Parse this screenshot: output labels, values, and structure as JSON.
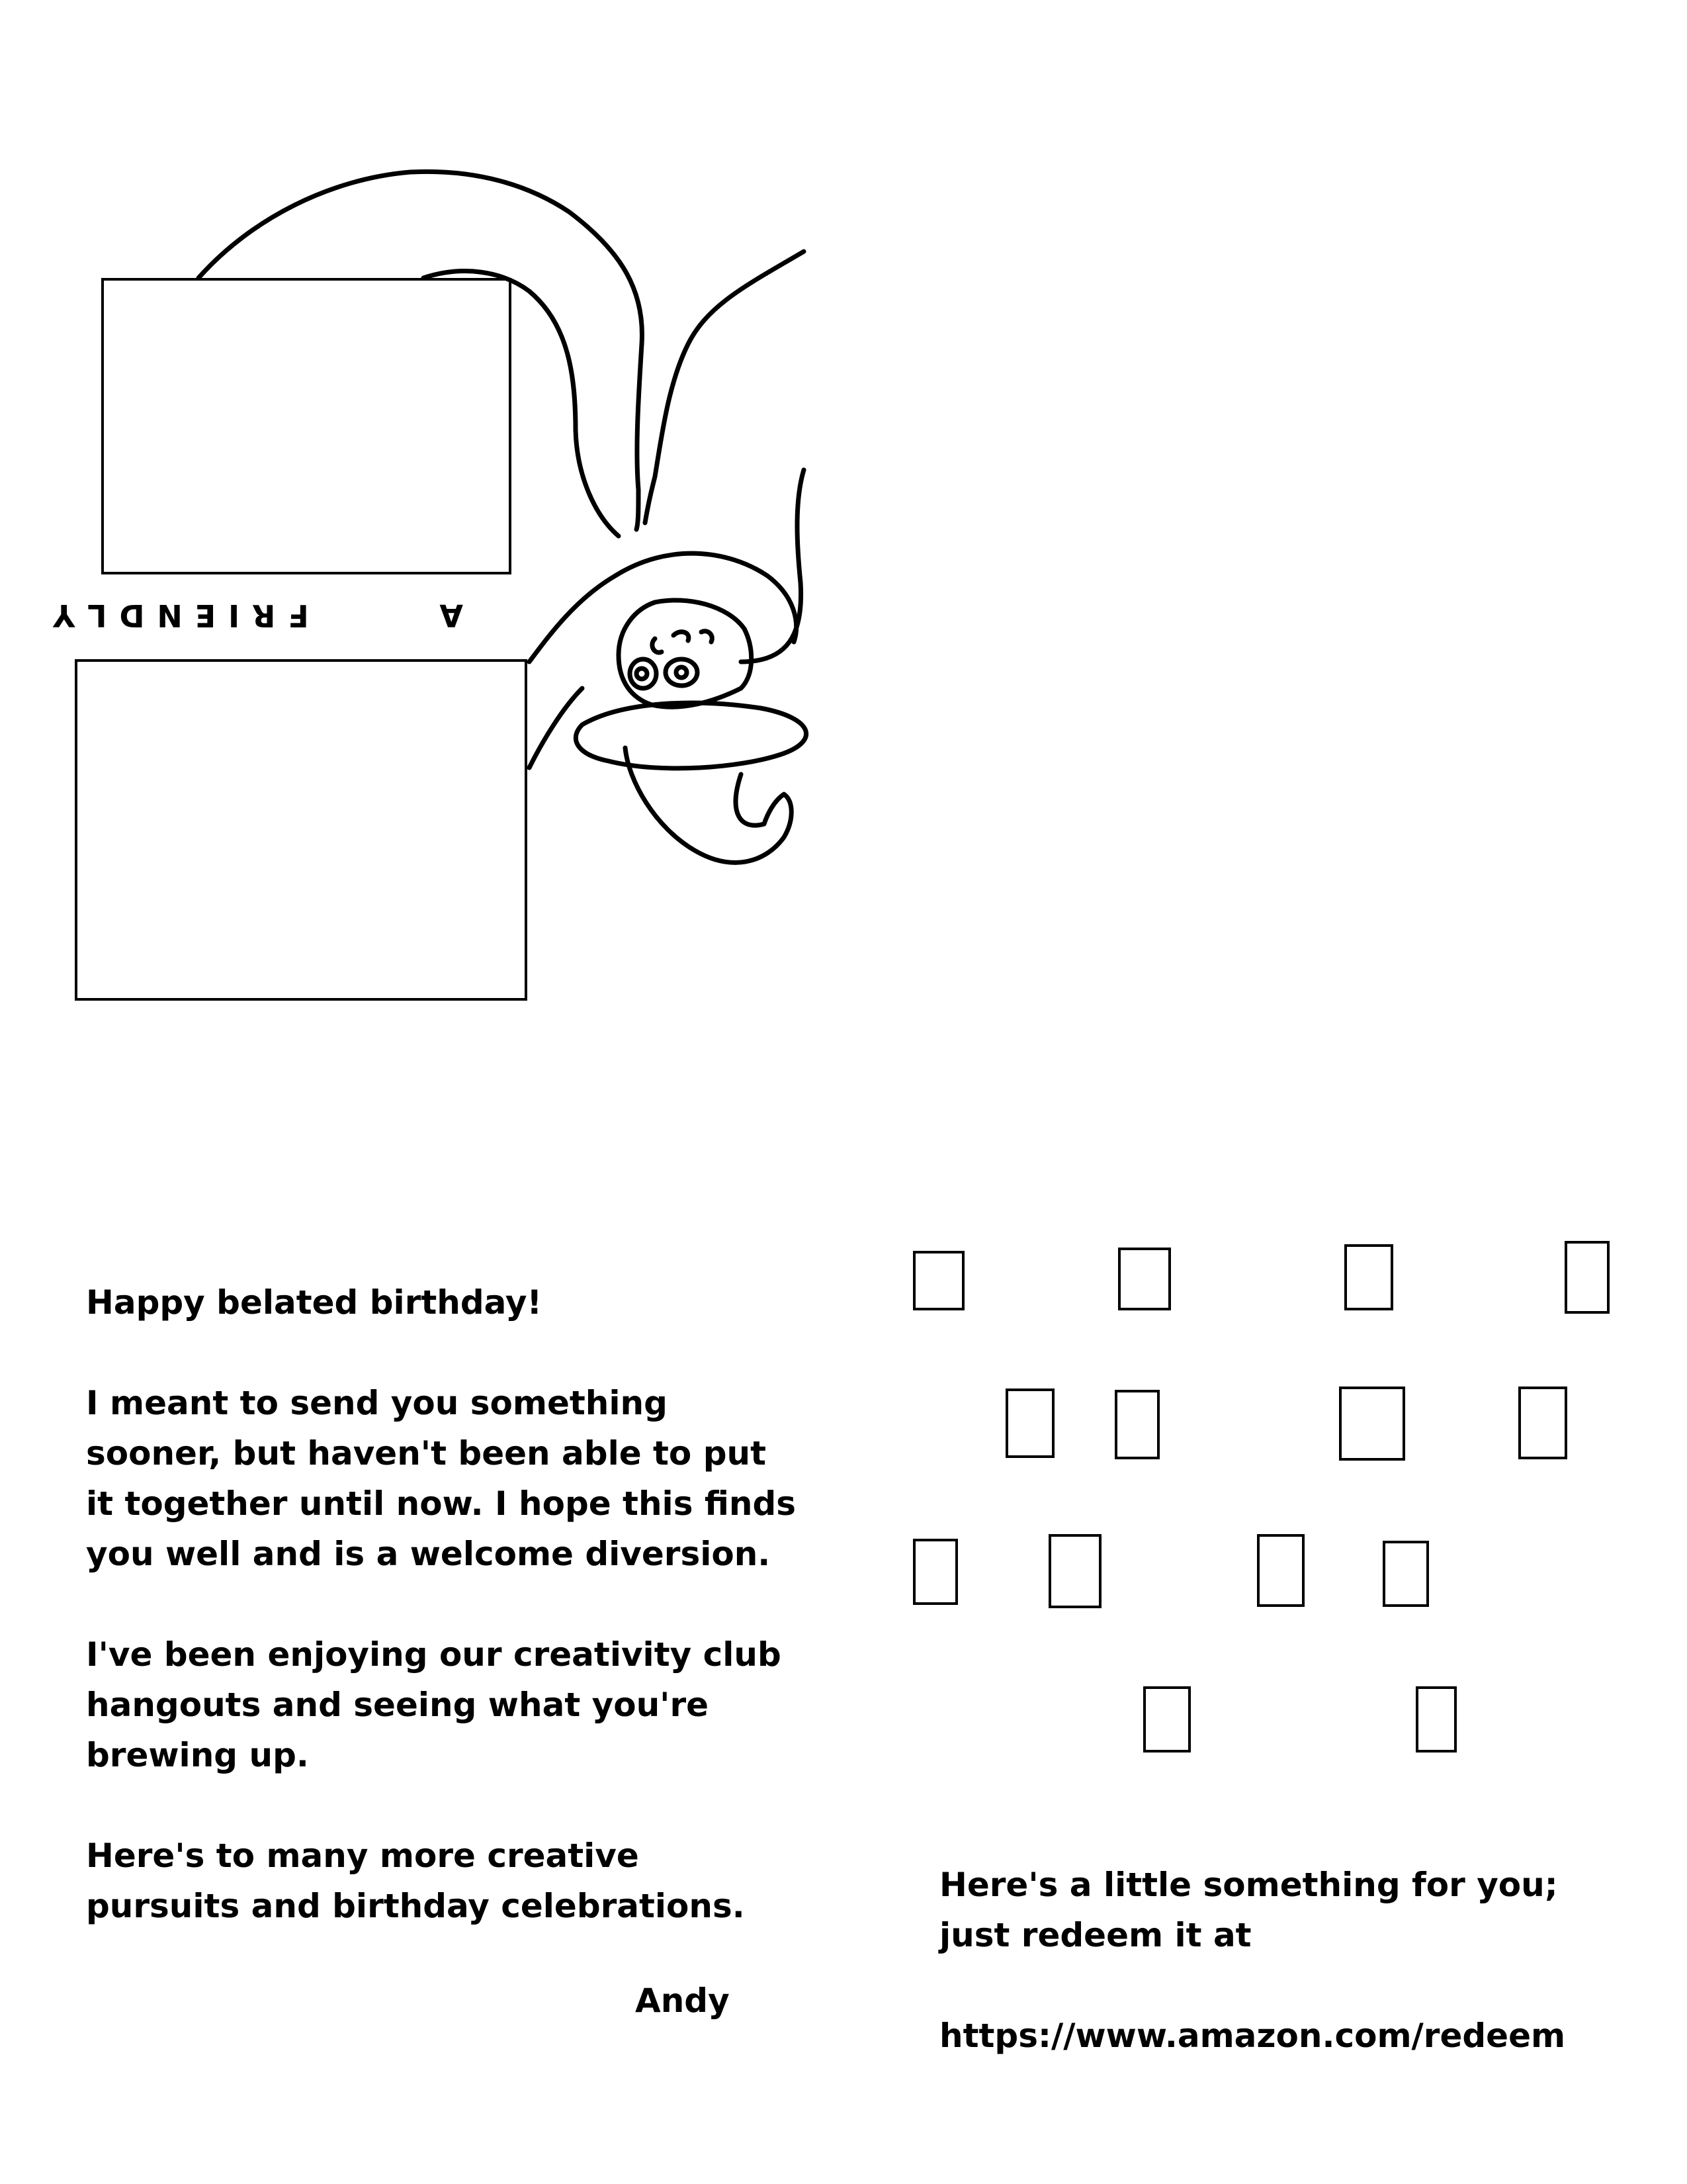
{
  "card_cover": {
    "rotated_text": [
      "A",
      "F",
      "R",
      "I",
      "E",
      "N",
      "D",
      "L",
      "Y"
    ],
    "illustration": "rotated-girl-with-long-hair-holding-frames-drawing"
  },
  "message": {
    "greeting": "Happy belated birthday!",
    "paragraph_1": "I meant to send you something sooner, but haven't been able to put it together until now. I hope this finds you well and is a welcome diversion.",
    "paragraph_2": "I've been enjoying our creativity club hangouts and seeing what you're brewing up.",
    "paragraph_3": "Here's to many more creative pursuits and birthday celebrations.",
    "signature": "Andy"
  },
  "gift": {
    "line": "Here's a little something for you; just redeem it at",
    "url": "https://www.amazon.com/redeem"
  },
  "code_glyphs": {
    "count": 14,
    "note_icon": "missing-glyph-box"
  }
}
